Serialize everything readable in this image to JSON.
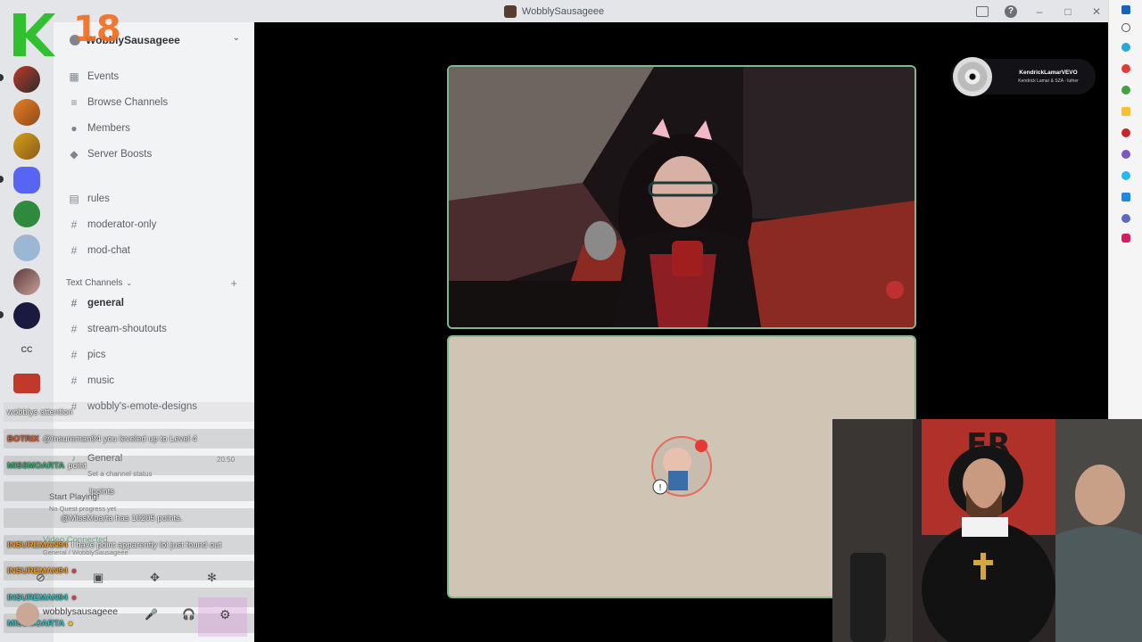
{
  "window": {
    "title": "WobblySausageee"
  },
  "logo": {
    "number": "18"
  },
  "server": {
    "name": "WobblySausageee"
  },
  "menu": [
    {
      "label": "Events",
      "icon": "calendar-icon"
    },
    {
      "label": "Browse Channels",
      "icon": "list-icon"
    },
    {
      "label": "Members",
      "icon": "members-icon"
    },
    {
      "label": "Server Boosts",
      "icon": "boost-icon"
    }
  ],
  "channels_top": [
    {
      "label": "rules",
      "icon": "rules-icon"
    },
    {
      "label": "moderator-only",
      "icon": "hash-icon"
    },
    {
      "label": "mod-chat",
      "icon": "hash-icon"
    }
  ],
  "category": {
    "label": "Text Channels"
  },
  "channels_text": [
    {
      "label": "general",
      "active": true
    },
    {
      "label": "stream-shoutouts"
    },
    {
      "label": "pics"
    },
    {
      "label": "music"
    },
    {
      "label": "wobbly's-emote-designs"
    }
  ],
  "server_rail": {
    "cc_label": "CC"
  },
  "voice": {
    "channel": "General",
    "time": "20:50",
    "status_hint": "Set a channel status",
    "activity_title": "Start Playing!",
    "activity_sub": "No Quest progress yet",
    "connected": "Video Connected",
    "connected_sub": "General / WobblySausageee"
  },
  "user": {
    "name": "wobblysausageee"
  },
  "chat": [
    {
      "user": "",
      "text": "wobblys attention"
    },
    {
      "user": "BOTRIX",
      "text": "@Insureman94 you leveled up to Level 4",
      "color": "#e05a2b"
    },
    {
      "user": "MISSMOARTA",
      "text": "point",
      "color": "#3fb37a"
    },
    {
      "user": "",
      "text": "!points"
    },
    {
      "user": "",
      "text": "@MissMoarta has 10205 points."
    },
    {
      "user": "INSUREMAN94",
      "text": "I have point apparently lol just found out",
      "color": "#f0a030"
    },
    {
      "user": "INSUREMAN94",
      "text": "",
      "color": "#f0a030"
    },
    {
      "user": "INSUREMAN94",
      "text": "",
      "color": "#3fc0c0"
    },
    {
      "user": "MISSMOARTA",
      "text": "",
      "color": "#3fc0c0"
    }
  ],
  "music": {
    "artist": "KendrickLamarVEVO",
    "song": "Kendrick Lamar & SZA - luther"
  }
}
